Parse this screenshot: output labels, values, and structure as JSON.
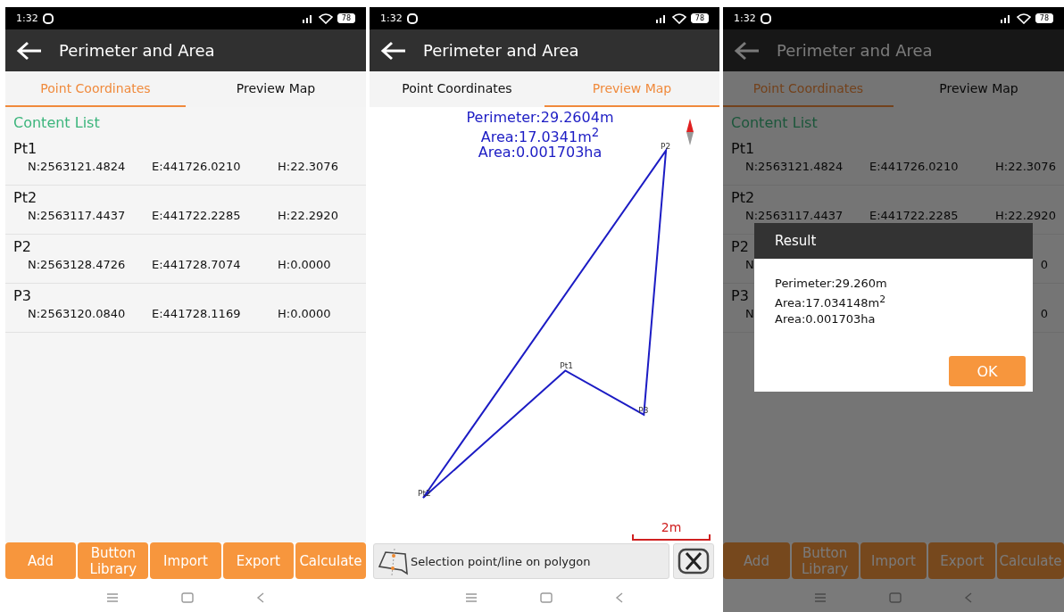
{
  "screens": [
    {
      "kind": "list",
      "status": {
        "time": "1:32",
        "battery": "78"
      },
      "title": "Perimeter and Area",
      "tabs": [
        {
          "label": "Point Coordinates",
          "selected": true
        },
        {
          "label": "Preview Map",
          "selected": false
        }
      ],
      "section": "Content List",
      "rows": [
        {
          "kind": "full",
          "name": "Pt1",
          "n": "N:2563121.4824",
          "e": "E:441726.0210",
          "h": "H:22.3076"
        },
        {
          "kind": "full",
          "name": "Pt2",
          "n": "N:2563117.4437",
          "e": "E:441722.2285",
          "h": "H:22.2920"
        },
        {
          "kind": "full",
          "name": "P2",
          "n": "N:2563128.4726",
          "e": "E:441728.7074",
          "h": "H:0.0000"
        },
        {
          "kind": "full",
          "name": "P3",
          "n": "N:2563120.0840",
          "e": "E:441728.1169",
          "h": "H:0.0000"
        }
      ],
      "buttons": [
        "Add",
        "Button Library",
        "Import",
        "Export",
        "Calculate"
      ]
    },
    {
      "kind": "map",
      "status": {
        "time": "1:32",
        "battery": "78"
      },
      "title": "Perimeter and Area",
      "tabs": [
        {
          "label": "Point Coordinates",
          "selected": false
        },
        {
          "label": "Preview Map",
          "selected": true
        }
      ],
      "results": [
        "Perimeter:29.2604m",
        "Area:17.0341m$^{2}$",
        "Area:0.001703ha"
      ],
      "points": [
        {
          "label": "Pt1"
        },
        {
          "label": "Pt2"
        },
        {
          "label": "P2"
        },
        {
          "label": "P3"
        }
      ],
      "scale": "2m",
      "selection": "Selection point/line on polygon"
    },
    {
      "kind": "list",
      "status": {
        "time": "1:32",
        "battery": "78"
      },
      "title": "Perimeter and Area",
      "tabs": [
        {
          "label": "Point Coordinates",
          "selected": true
        },
        {
          "label": "Preview Map",
          "selected": false
        }
      ],
      "section": "Content List",
      "rows": [
        {
          "kind": "full",
          "name": "Pt1",
          "n": "N:2563121.4824",
          "e": "E:441726.0210",
          "h": "H:22.3076"
        },
        {
          "kind": "full",
          "name": "Pt2",
          "n": "N:2563117.4437",
          "e": "E:441722.2285",
          "h": "H:22.2920"
        },
        {
          "kind": "partial",
          "name": "P2",
          "n": "N",
          "h": "0"
        },
        {
          "kind": "partial",
          "name": "P3",
          "n": "N",
          "h": "0"
        }
      ],
      "buttons": [
        "Add",
        "Button Library",
        "Import",
        "Export",
        "Calculate"
      ],
      "dialog": {
        "title": "Result",
        "lines": [
          "Perimeter:29.260m",
          "Area:17.034148m$^{2}$",
          "Area:0.001703ha"
        ],
        "button": "OK"
      }
    }
  ]
}
